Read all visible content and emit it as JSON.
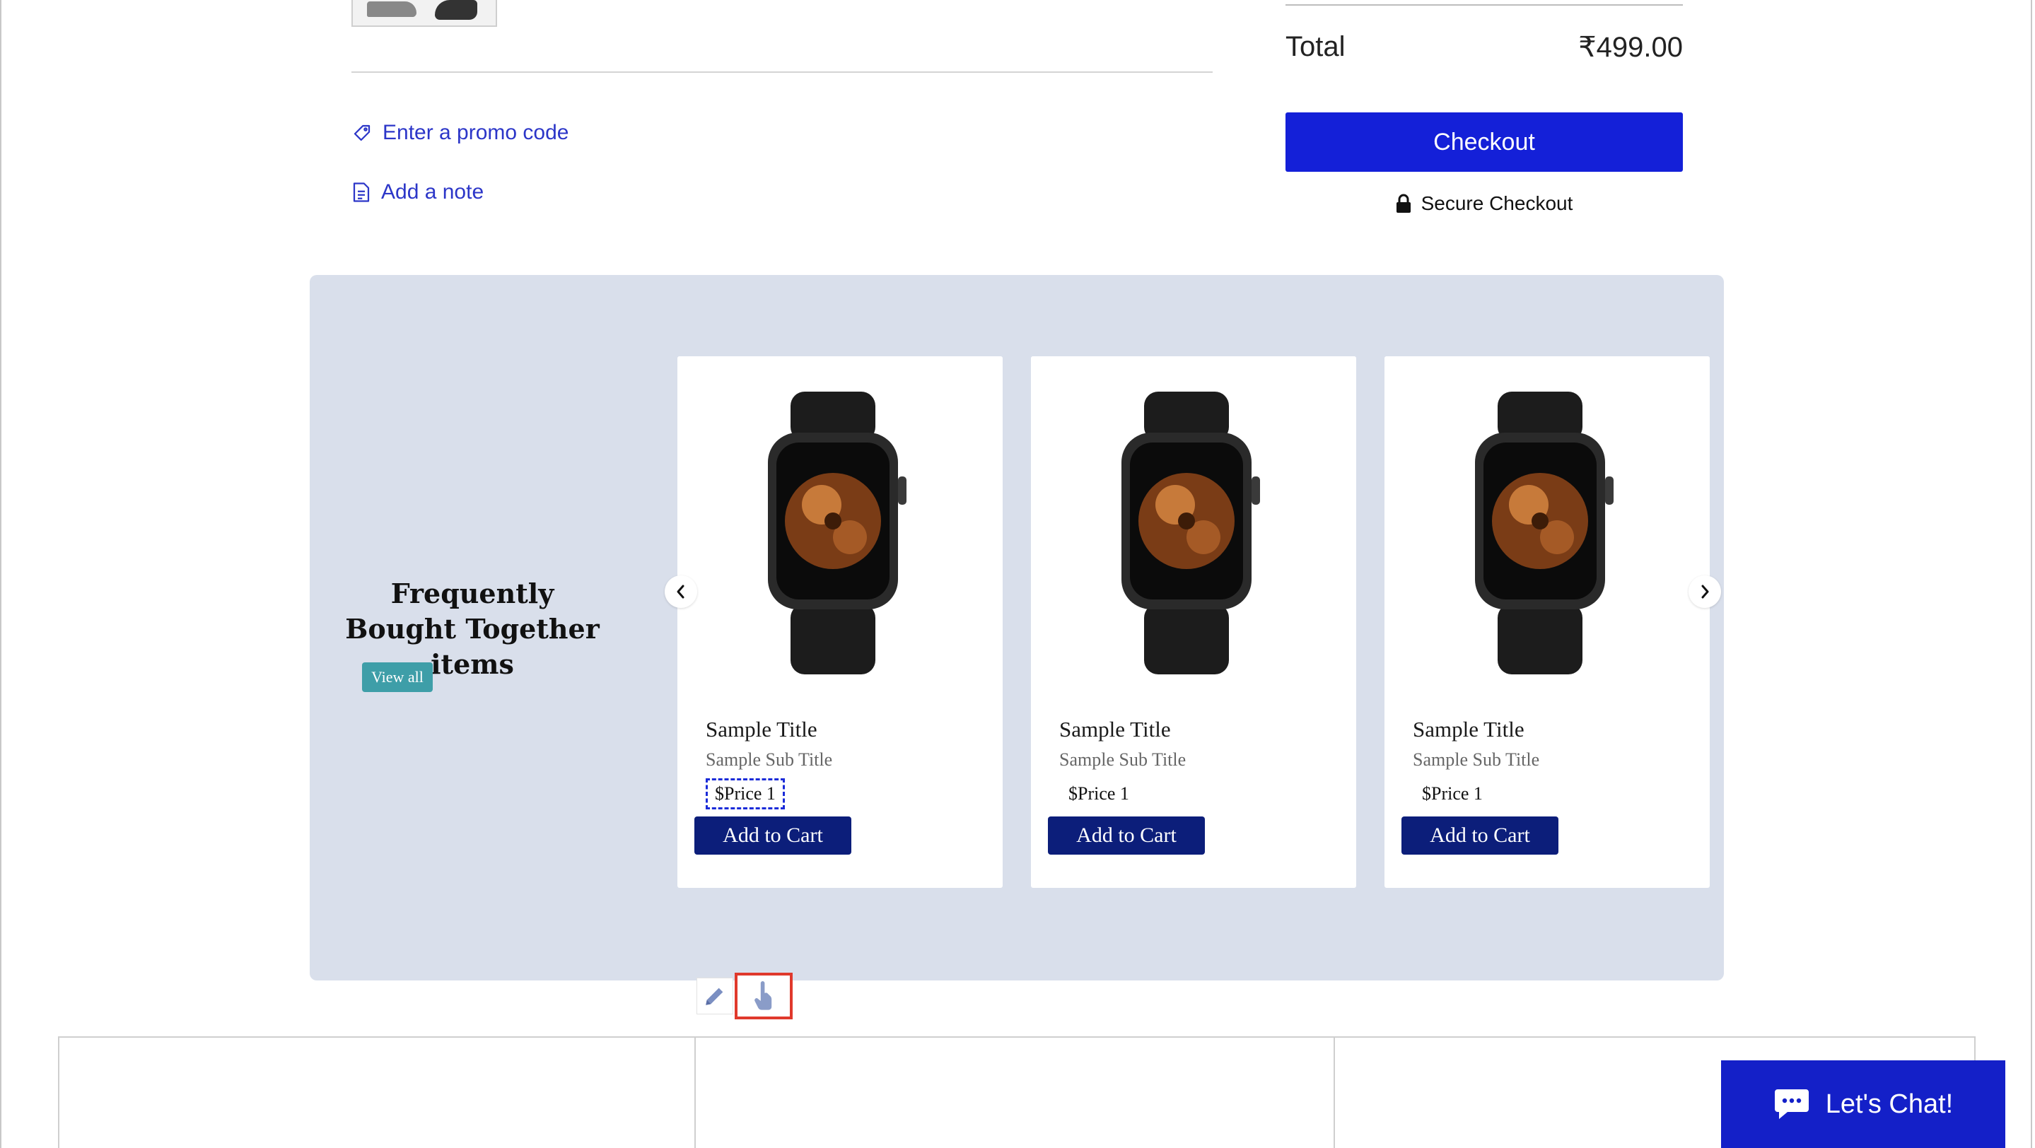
{
  "cart": {
    "promo_link": "Enter a promo code",
    "note_link": "Add a note"
  },
  "summary": {
    "total_label": "Total",
    "total_value": "₹499.00",
    "checkout_label": "Checkout",
    "secure_label": "Secure Checkout"
  },
  "fbt": {
    "title": "Frequently Bought Together items",
    "view_all": "View all",
    "cards": [
      {
        "title": "Sample Title",
        "subtitle": "Sample Sub Title",
        "price": "$Price 1",
        "button": "Add to Cart"
      },
      {
        "title": "Sample Title",
        "subtitle": "Sample Sub Title",
        "price": "$Price 1",
        "button": "Add to Cart"
      },
      {
        "title": "Sample Title",
        "subtitle": "Sample Sub Title",
        "price": "$Price 1",
        "button": "Add to Cart"
      }
    ]
  },
  "chat": {
    "label": "Let's Chat!"
  },
  "icons": {
    "promo": "tag-icon",
    "note": "note-icon",
    "secure": "lock-icon",
    "prev": "chevron-left-icon",
    "next": "chevron-right-icon",
    "edit": "pencil-icon",
    "touch": "hand-pointer-icon",
    "chat": "chat-bubble-icon"
  },
  "colors": {
    "link": "#2c36c8",
    "checkout": "#1420d8",
    "section_bg": "#d9dfeb",
    "view_all": "#3e9ea8",
    "add_to_cart": "#0c1e7a",
    "chat": "#1420c8",
    "highlight": "#e0392c"
  }
}
